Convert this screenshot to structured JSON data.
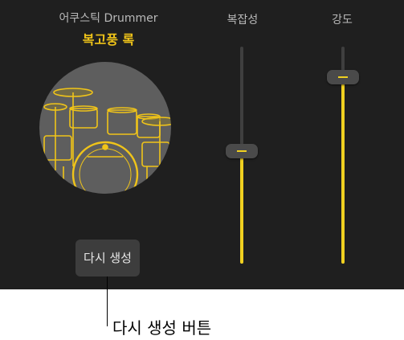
{
  "drummer": {
    "name": "어쿠스틱 Drummer",
    "genre": "복고풍 록"
  },
  "sliders": {
    "complexity": {
      "label": "복잡성",
      "value": 0.52
    },
    "loudness": {
      "label": "강도",
      "value": 0.86
    }
  },
  "regenerate_button": {
    "label": "다시 생성"
  },
  "callout": {
    "text": "다시 생성 버튼"
  },
  "colors": {
    "accent": "#f0c419",
    "panel_background": "#1f1f1f"
  },
  "icons": {
    "drum_kit": "drum-kit-icon"
  }
}
